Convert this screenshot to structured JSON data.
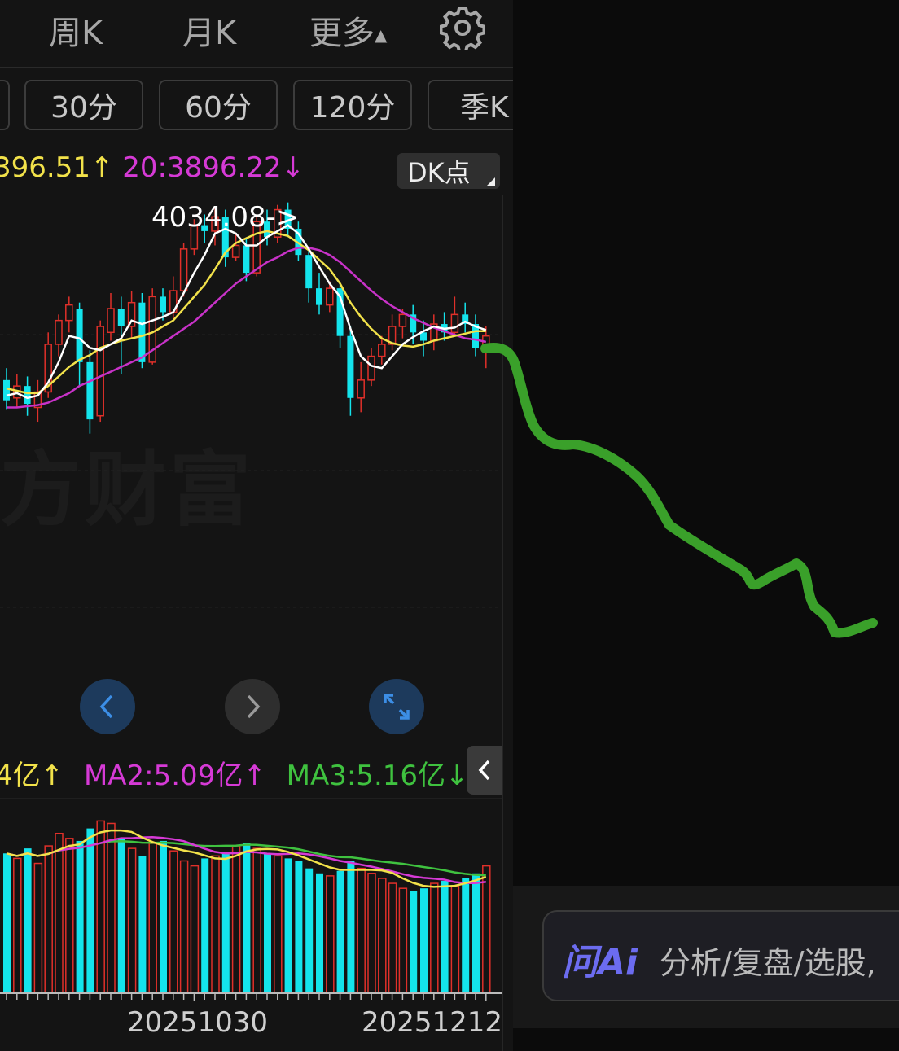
{
  "tabs": [
    {
      "label": "周K"
    },
    {
      "label": "月K"
    },
    {
      "label": "更多",
      "caret": "▲"
    }
  ],
  "periods": [
    "30分",
    "60分",
    "120分",
    "季K"
  ],
  "ma_legend": {
    "ma10_text": "396.51↑",
    "ma20_text": "20:3896.22↓",
    "ma10_color": "#f2e24a",
    "ma20_color": "#d63ad6"
  },
  "dk_button": {
    "label": "DK点"
  },
  "high_label": "4034.08->",
  "watermark": "方财富",
  "volume_legend": {
    "ma1_text": "4亿↑",
    "ma2_text": "MA2:5.09亿↑",
    "ma3_text": "MA3:5.16亿↓",
    "ma1_color": "#f2e24a",
    "ma2_color": "#d63ad6",
    "ma3_color": "#3fc23f"
  },
  "dates": [
    "20251030",
    "20251212"
  ],
  "ai_bar": {
    "logo": "问Ai",
    "placeholder": "分析/复盘/选股,"
  },
  "colors": {
    "up": "#e0302a",
    "down": "#14e4ec",
    "annotation": "#3aa02a",
    "background": "#141414"
  },
  "chart_data": {
    "type": "candlestick",
    "y_high_marker": 4034.08,
    "candles": [
      [
        3885,
        3868,
        3895,
        3860
      ],
      [
        3870,
        3880,
        3890,
        3862
      ],
      [
        3880,
        3865,
        3888,
        3855
      ],
      [
        3862,
        3875,
        3885,
        3850
      ],
      [
        3875,
        3915,
        3925,
        3870
      ],
      [
        3915,
        3935,
        3940,
        3905
      ],
      [
        3935,
        3948,
        3955,
        3925
      ],
      [
        3945,
        3900,
        3950,
        3880
      ],
      [
        3900,
        3852,
        3910,
        3840
      ],
      [
        3855,
        3930,
        3935,
        3850
      ],
      [
        3925,
        3945,
        3958,
        3918
      ],
      [
        3945,
        3930,
        3955,
        3890
      ],
      [
        3930,
        3950,
        3960,
        3920
      ],
      [
        3950,
        3900,
        3958,
        3895
      ],
      [
        3900,
        3955,
        3962,
        3898
      ],
      [
        3955,
        3942,
        3962,
        3935
      ],
      [
        3942,
        3960,
        3972,
        3935
      ],
      [
        3960,
        3995,
        4000,
        3955
      ],
      [
        3995,
        4015,
        4020,
        3990
      ],
      [
        4015,
        4010,
        4024,
        4000
      ],
      [
        4010,
        4022,
        4030,
        3998
      ],
      [
        4022,
        3988,
        4028,
        3980
      ],
      [
        3988,
        3998,
        4008,
        3985
      ],
      [
        3998,
        3975,
        4004,
        3968
      ],
      [
        3975,
        4018,
        4024,
        3972
      ],
      [
        4018,
        4005,
        4028,
        3998
      ],
      [
        4005,
        4028,
        4032,
        4000
      ],
      [
        4028,
        4012,
        4034.08,
        4005
      ],
      [
        4012,
        3990,
        4018,
        3985
      ],
      [
        3990,
        3962,
        3995,
        3950
      ],
      [
        3962,
        3948,
        3975,
        3940
      ],
      [
        3948,
        3962,
        3968,
        3942
      ],
      [
        3962,
        3922,
        3966,
        3912
      ],
      [
        3922,
        3870,
        3930,
        3855
      ],
      [
        3870,
        3885,
        3900,
        3858
      ],
      [
        3885,
        3905,
        3912,
        3880
      ],
      [
        3905,
        3915,
        3922,
        3898
      ],
      [
        3915,
        3930,
        3940,
        3910
      ],
      [
        3930,
        3940,
        3945,
        3920
      ],
      [
        3940,
        3925,
        3948,
        3915
      ],
      [
        3925,
        3918,
        3935,
        3905
      ],
      [
        3918,
        3932,
        3940,
        3910
      ],
      [
        3932,
        3925,
        3942,
        3918
      ],
      [
        3925,
        3940,
        3955,
        3922
      ],
      [
        3940,
        3932,
        3950,
        3925
      ],
      [
        3932,
        3912,
        3940,
        3905
      ],
      [
        3910,
        3922,
        3930,
        3895
      ]
    ],
    "ma5": [
      3872,
      3874,
      3870,
      3872,
      3883,
      3900,
      3922,
      3920,
      3912,
      3910,
      3915,
      3920,
      3935,
      3932,
      3935,
      3938,
      3942,
      3958,
      3975,
      3990,
      4008,
      4012,
      4008,
      3998,
      3998,
      4005,
      4010,
      4015,
      4008,
      3995,
      3980,
      3966,
      3955,
      3928,
      3905,
      3897,
      3895,
      3905,
      3915,
      3921,
      3926,
      3930,
      3928,
      3929,
      3934,
      3930,
      3927
    ],
    "ma10": [
      3878,
      3876,
      3874,
      3874,
      3880,
      3888,
      3896,
      3902,
      3906,
      3912,
      3915,
      3918,
      3920,
      3922,
      3925,
      3930,
      3935,
      3945,
      3955,
      3965,
      3978,
      3992,
      4000,
      4004,
      4008,
      4010,
      4008,
      4006,
      4000,
      3994,
      3986,
      3978,
      3966,
      3950,
      3938,
      3928,
      3920,
      3916,
      3914,
      3913,
      3915,
      3918,
      3920,
      3922,
      3924,
      3926,
      3926
    ],
    "ma20": [
      3862,
      3862,
      3863,
      3864,
      3866,
      3870,
      3874,
      3880,
      3884,
      3888,
      3892,
      3896,
      3900,
      3904,
      3910,
      3916,
      3922,
      3928,
      3934,
      3942,
      3950,
      3958,
      3966,
      3972,
      3978,
      3984,
      3988,
      3993,
      3996,
      3996,
      3994,
      3990,
      3984,
      3976,
      3968,
      3960,
      3953,
      3947,
      3942,
      3937,
      3933,
      3929,
      3926,
      3923,
      3920,
      3919,
      3917
    ],
    "volume": [
      5.6,
      5.4,
      5.8,
      5.2,
      5.9,
      6.4,
      6.2,
      6.1,
      6.6,
      6.9,
      6.8,
      6.2,
      5.8,
      5.5,
      6.0,
      6.1,
      5.7,
      5.3,
      5.1,
      5.4,
      5.5,
      5.6,
      5.9,
      6.0,
      5.8,
      5.6,
      5.5,
      5.4,
      5.3,
      5.0,
      4.8,
      4.7,
      4.9,
      5.3,
      5.0,
      4.8,
      4.6,
      4.4,
      4.2,
      4.1,
      4.2,
      4.4,
      4.5,
      4.3,
      4.6,
      4.8,
      5.1
    ]
  }
}
